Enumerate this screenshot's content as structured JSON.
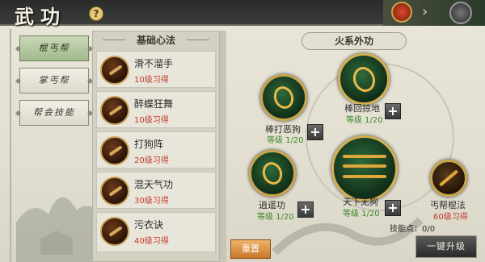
{
  "header": {
    "title": "武功",
    "help_icon": "?"
  },
  "tabs": [
    {
      "label": "棍丐帮",
      "active": true
    },
    {
      "label": "掌丐帮",
      "active": false
    },
    {
      "label": "帮会技能",
      "active": false
    }
  ],
  "basic": {
    "title": "基础心法",
    "items": [
      {
        "name": "滑不溜手",
        "req": "10级习得"
      },
      {
        "name": "醉蝶狂舞",
        "req": "10级习得"
      },
      {
        "name": "打狗阵",
        "req": "20级习得"
      },
      {
        "name": "混天气功",
        "req": "30级习得"
      },
      {
        "name": "污衣诀",
        "req": "40级习得"
      }
    ]
  },
  "tree": {
    "title": "火系外功",
    "skills": {
      "huiliang": {
        "name": "棒回掠地",
        "level": "等级 1/20",
        "icon": "staff-spin-icon"
      },
      "bangda": {
        "name": "棒打恶狗",
        "level": "等级 1/20",
        "icon": "dragon-icon"
      },
      "xiaoyao": {
        "name": "逍遥功",
        "level": "等级 1/20",
        "icon": "wind-icon"
      },
      "tianxia": {
        "name": "天下无狗",
        "level": "等级 1/20",
        "icon": "staves-icon"
      },
      "gaibang": {
        "name": "丐帮棍法",
        "req": "60级习得",
        "icon": "staff-icon"
      }
    },
    "plus_label": "+",
    "skill_points": "技能点：0/0"
  },
  "buttons": {
    "reset": "重置",
    "upgrade": "一键升级"
  },
  "colors": {
    "active_tab": "#a3b88e",
    "level_green": "#3c8a2a",
    "req_red": "#c23a2a",
    "icon_gold": "#c9a54a"
  }
}
